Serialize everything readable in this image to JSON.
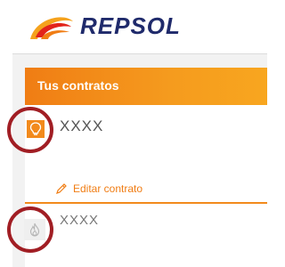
{
  "brand": {
    "name": "REPSOL",
    "colors": {
      "navy": "#1f2a6b",
      "orange": "#f07d14",
      "red": "#e2231a"
    }
  },
  "contracts_card": {
    "title": "Tus contratos",
    "contracts": [
      {
        "name": "XXXX",
        "icon": "lightbulb-icon",
        "status": "active"
      },
      {
        "name": "XXXX",
        "icon": "gas-flame-icon",
        "status": "inactive"
      }
    ],
    "edit_label": "Editar contrato",
    "edit_icon": "pencil-icon"
  },
  "annotations": {
    "color": "#a11e24"
  }
}
